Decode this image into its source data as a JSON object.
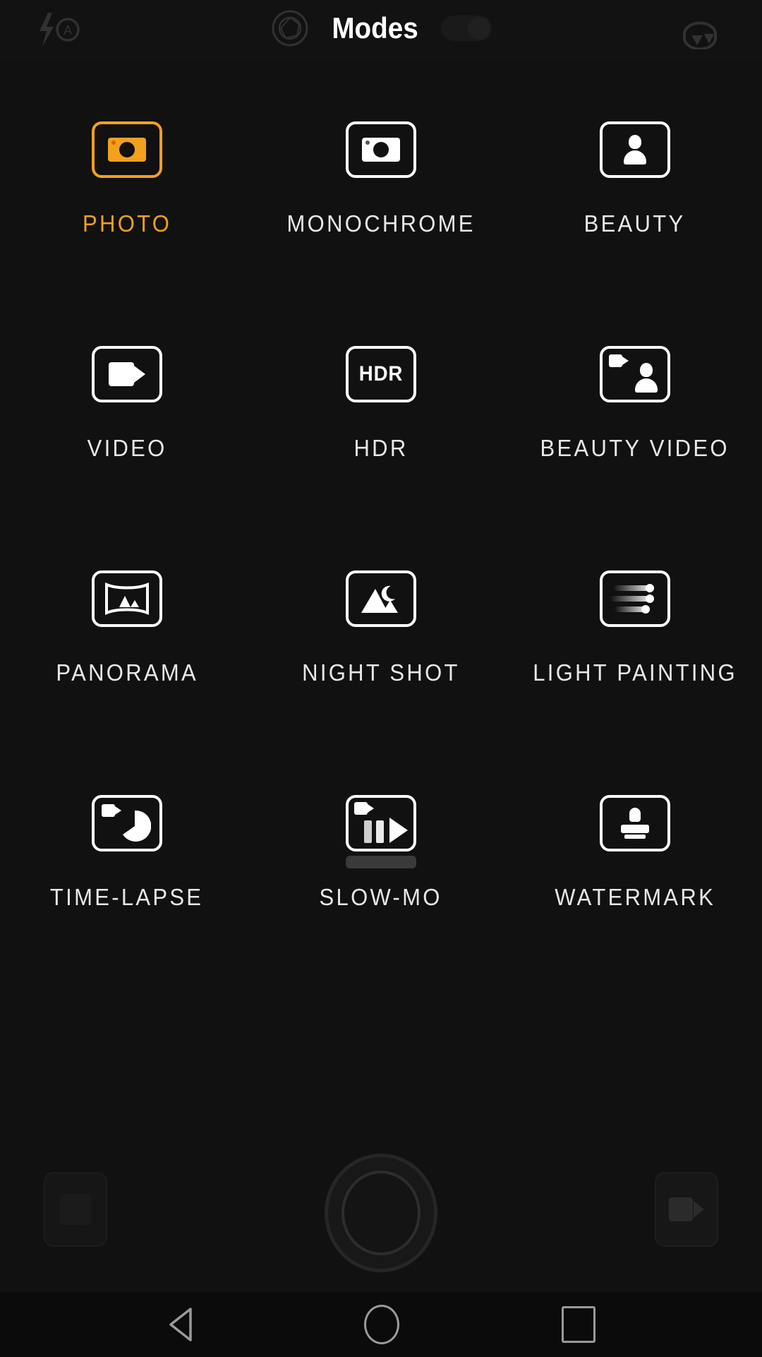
{
  "app": {
    "screen_title": "Modes",
    "background_color": "#111111",
    "accent_color": "#F2A01D"
  },
  "topbar": {
    "flash_icon": "flash-auto-icon",
    "aperture_icon": "aperture-icon",
    "title": "Modes",
    "toggle_icon": "toggle-switch",
    "flip_camera_icon": "flip-camera-icon"
  },
  "modes": [
    {
      "label": "PHOTO",
      "icon": "photo-camera-icon",
      "selected": true
    },
    {
      "label": "MONOCHROME",
      "icon": "mono-camera-icon",
      "selected": false
    },
    {
      "label": "BEAUTY",
      "icon": "beauty-person-icon",
      "selected": false
    },
    {
      "label": "VIDEO",
      "icon": "camcorder-icon",
      "selected": false
    },
    {
      "label": "HDR",
      "icon": "hdr-text-icon",
      "selected": false
    },
    {
      "label": "BEAUTY VIDEO",
      "icon": "beauty-video-icon",
      "selected": false
    },
    {
      "label": "PANORAMA",
      "icon": "panorama-icon",
      "selected": false
    },
    {
      "label": "NIGHT SHOT",
      "icon": "night-shot-icon",
      "selected": false
    },
    {
      "label": "LIGHT PAINTING",
      "icon": "light-trails-icon",
      "selected": false
    },
    {
      "label": "TIME-LAPSE",
      "icon": "time-lapse-icon",
      "selected": false
    },
    {
      "label": "SLOW-MO",
      "icon": "slow-motion-icon",
      "selected": false
    },
    {
      "label": "WATERMARK",
      "icon": "stamp-icon",
      "selected": false
    }
  ],
  "hdr_icon_text": "HDR",
  "bottom_controls": {
    "gallery_thumbnail": "gallery-thumbnail",
    "shutter_button": "shutter-button",
    "record_button": "video-record-button"
  },
  "navbar": {
    "back": "back-icon",
    "home": "home-icon",
    "recents": "recents-icon"
  }
}
